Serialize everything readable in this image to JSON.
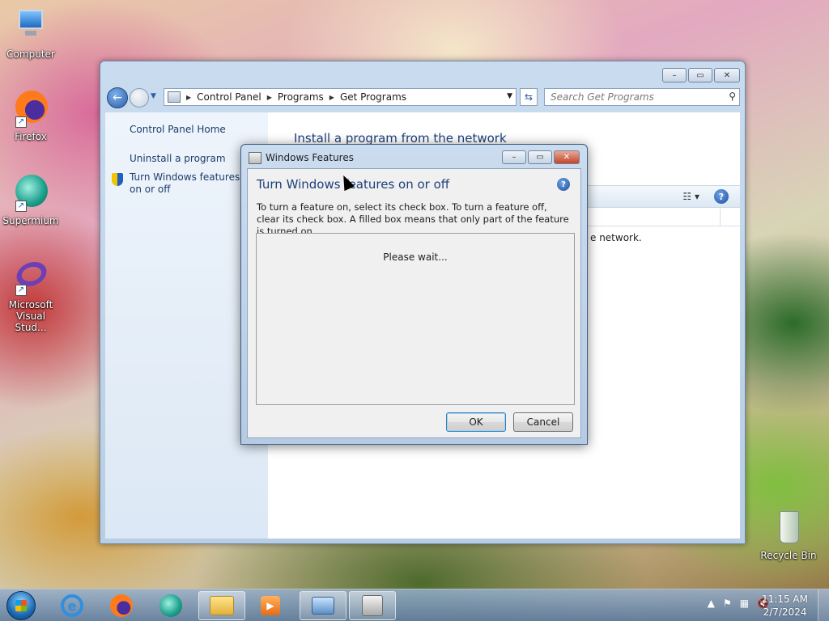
{
  "desktop": {
    "icons": [
      {
        "label": "Computer",
        "icon": "computer-icon"
      },
      {
        "label": "Firefox",
        "icon": "firefox-icon"
      },
      {
        "label": "Supermium",
        "icon": "supermium-icon"
      },
      {
        "label": "Microsoft Visual Stud...",
        "icon": "visual-studio-icon"
      },
      {
        "label": "Recycle Bin",
        "icon": "recycle-bin-icon"
      }
    ]
  },
  "explorer": {
    "breadcrumb": [
      "Control Panel",
      "Programs",
      "Get Programs"
    ],
    "search_placeholder": "Search Get Programs",
    "left_pane": {
      "home_link": "Control Panel Home",
      "uninstall_link": "Uninstall a program",
      "features_link": "Turn Windows features on or off"
    },
    "content": {
      "title": "Install a program from the network",
      "partial_text": "e network."
    },
    "controls": {
      "minimize": "–",
      "maximize": "▭",
      "close": "✕"
    }
  },
  "dialog": {
    "title": "Windows Features",
    "heading": "Turn Windows features on or off",
    "description": "To turn a feature on, select its check box. To turn a feature off, clear its check box. A filled box means that only part of the feature is turned on.",
    "status": "Please wait...",
    "ok_label": "OK",
    "cancel_label": "Cancel",
    "help": "?"
  },
  "taskbar": {
    "pinned": [
      {
        "name": "internet-explorer",
        "icon": "internet-explorer-icon"
      },
      {
        "name": "firefox",
        "icon": "firefox-icon"
      },
      {
        "name": "supermium",
        "icon": "supermium-icon"
      },
      {
        "name": "file-explorer",
        "icon": "folder-icon"
      },
      {
        "name": "media-player",
        "icon": "media-player-icon"
      },
      {
        "name": "control-panel",
        "icon": "control-panel-icon"
      },
      {
        "name": "windows-features",
        "icon": "windows-features-icon"
      }
    ],
    "clock": {
      "time": "11:15 AM",
      "date": "2/7/2024"
    }
  }
}
